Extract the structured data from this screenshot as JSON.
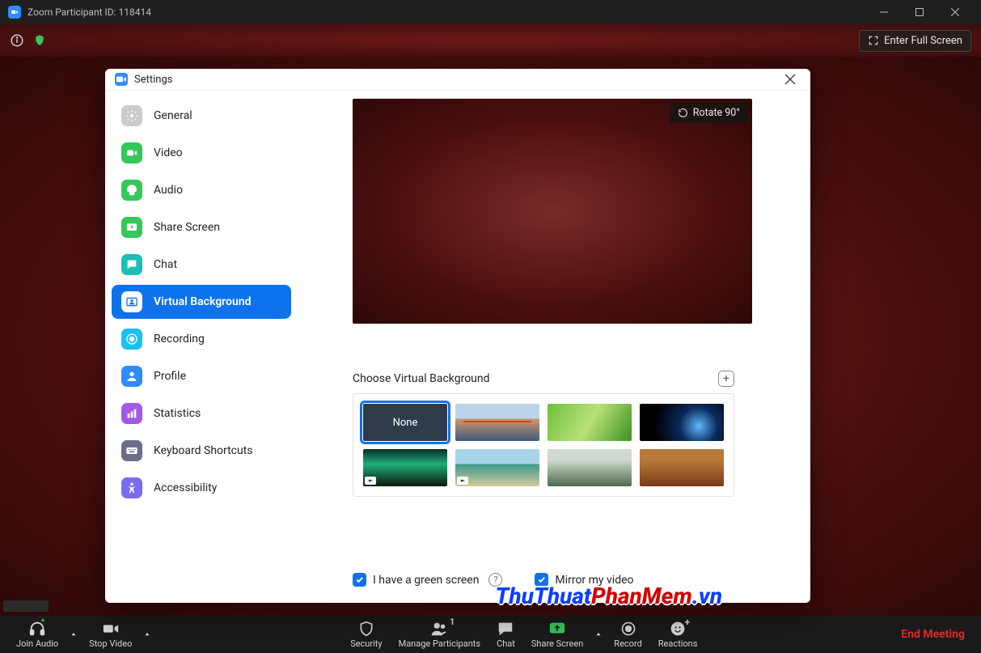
{
  "titlebar": {
    "title": "Zoom Participant ID: 118414"
  },
  "statusrow": {
    "enter_full": "Enter Full Screen"
  },
  "bottombar": {
    "join_audio": "Join Audio",
    "stop_video": "Stop Video",
    "security": "Security",
    "manage_participants": "Manage Participants",
    "participants_count": "1",
    "chat": "Chat",
    "share_screen": "Share Screen",
    "record": "Record",
    "reactions": "Reactions",
    "end_meeting": "End Meeting"
  },
  "dialog": {
    "title": "Settings",
    "nav": {
      "general": "General",
      "video": "Video",
      "audio": "Audio",
      "share_screen": "Share Screen",
      "chat": "Chat",
      "virtual_background": "Virtual Background",
      "recording": "Recording",
      "profile": "Profile",
      "statistics": "Statistics",
      "keyboard_shortcuts": "Keyboard Shortcuts",
      "accessibility": "Accessibility"
    },
    "content": {
      "rotate": "Rotate 90°",
      "choose_label": "Choose Virtual Background",
      "none_label": "None",
      "green_screen": "I have a green screen",
      "mirror": "Mirror my video"
    }
  },
  "watermark": {
    "part1": "ThuThuat",
    "part2": "PhanMem",
    "part3": ".vn"
  }
}
